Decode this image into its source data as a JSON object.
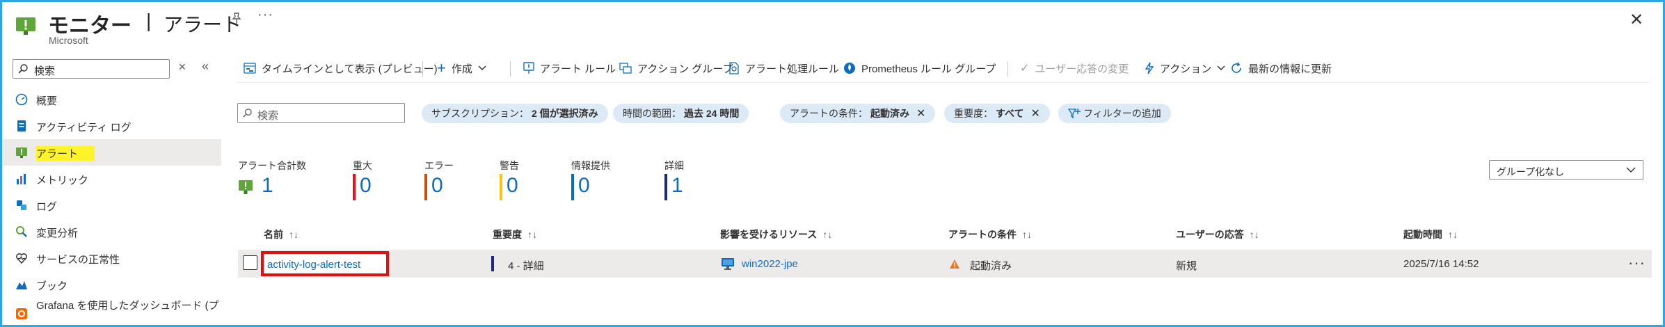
{
  "header": {
    "title": "モニター",
    "separator": "|",
    "subtitle_title": "アラート",
    "publisher": "Microsoft",
    "more": "···",
    "close": "✕"
  },
  "sidebar": {
    "search_placeholder": "検索",
    "items": [
      {
        "label": "概要",
        "icon": "gauge-icon"
      },
      {
        "label": "アクティビティ ログ",
        "icon": "activity-log-icon"
      },
      {
        "label": "アラート",
        "icon": "alert-icon",
        "active": true
      },
      {
        "label": "メトリック",
        "icon": "metrics-icon"
      },
      {
        "label": "ログ",
        "icon": "logs-icon"
      },
      {
        "label": "変更分析",
        "icon": "change-analysis-icon"
      },
      {
        "label": "サービスの正常性",
        "icon": "heart-icon"
      },
      {
        "label": "ブック",
        "icon": "workbook-icon"
      },
      {
        "label": "Grafana を使用したダッシュボード (プ",
        "icon": "grafana-icon"
      }
    ]
  },
  "toolbar": {
    "timeline": "タイムラインとして表示 (プレビュー)",
    "create": "作成",
    "alert_rules": "アラート ルール",
    "action_groups": "アクション グループ",
    "alert_processing": "アラート処理ルール",
    "prometheus": "Prometheus ルール グループ",
    "change_response": "ユーザー応答の変更",
    "action": "アクション",
    "refresh": "最新の情報に更新"
  },
  "filters": {
    "search_placeholder": "検索",
    "subscription_label": "サブスクリプション：",
    "subscription_value": "2 個が選択済み",
    "time_label": "時間の範囲：",
    "time_value": "過去 24 時間",
    "condition_label": "アラートの条件：",
    "condition_value": "起動済み",
    "severity_label": "重要度：",
    "severity_value": "すべて",
    "add_filter": "フィルターの追加"
  },
  "summary": {
    "total_label": "アラート合計数",
    "total_value": "1",
    "critical_label": "重大",
    "critical_value": "0",
    "error_label": "エラー",
    "error_value": "0",
    "warning_label": "警告",
    "warning_value": "0",
    "info_label": "情報提供",
    "info_value": "0",
    "verbose_label": "詳細",
    "verbose_value": "1",
    "colors": {
      "critical": "#e81123",
      "error": "#ca5010",
      "warning": "#f2c811",
      "info": "#0f6cbd",
      "verbose": "#1b2a7c"
    }
  },
  "group_select": {
    "value": "グループ化なし"
  },
  "table": {
    "columns": [
      "名前",
      "重要度",
      "影響を受けるリソース",
      "アラートの条件",
      "ユーザーの応答",
      "起動時間"
    ],
    "sort_glyph": "↑↓",
    "rows": [
      {
        "name": "activity-log-alert-test",
        "severity": "4 - 詳細",
        "resource": "win2022-jpe",
        "condition": "起動済み",
        "response": "新規",
        "fired_time": "2025/7/16 14:52"
      }
    ]
  }
}
